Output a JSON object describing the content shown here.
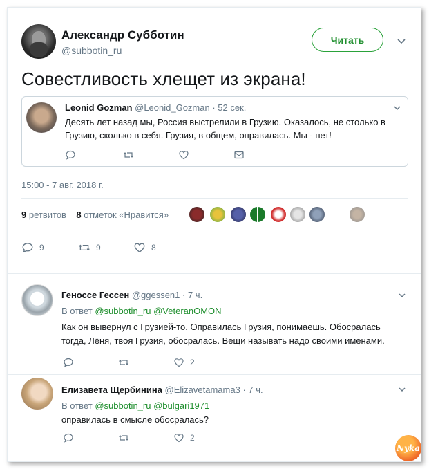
{
  "tweet": {
    "author_name": "Александр Субботин",
    "author_handle": "@subbotin_ru",
    "follow_label": "Читать",
    "text": "Совестливость хлещет из экрана!",
    "timestamp": "15:00 - 7 авг. 2018 г.",
    "retweets_count": "9",
    "retweets_label": "ретвитов",
    "likes_count": "8",
    "likes_label": "отметок «Нравится»",
    "reply_count": "9",
    "retweet_count_action": "9",
    "like_count_action": "8"
  },
  "quote": {
    "author_name": "Leonid Gozman",
    "author_handle": "@Leonid_Gozman",
    "time": "· 52 сек.",
    "text": "Десять лет назад мы, Россия выстрелили в Грузию. Оказалось, не столько в Грузию, сколько в себя. Грузия, в общем, оправилась. Мы - нет!"
  },
  "replies": [
    {
      "author_name": "Геноссе Гессен",
      "author_handle": "@ggessen1",
      "time": "· 7 ч.",
      "reply_to_prefix": "В ответ",
      "reply_to_1": "@subbotin_ru",
      "reply_to_2": "@VeteranOMON",
      "text": "Как он вывернул с Грузией-то. Оправилась Грузия, понимаешь. Обосралась тогда, Лёня, твоя Грузия, обосралась.  Вещи называть надо своими именами.",
      "like_count": "2"
    },
    {
      "author_name": "Елизавета Щербинина",
      "author_handle": "@Elizavetamama3",
      "time": "· 7 ч.",
      "reply_to_prefix": "В ответ",
      "reply_to_1": "@subbotin_ru",
      "reply_to_2": "@bulgari1971",
      "text": "оправилась в смысле обосралась?",
      "like_count": "2"
    }
  ],
  "watermark": "Nyka",
  "colors": {
    "accent_green": "#1f8f2e",
    "muted": "#657786",
    "border": "#e6ecf0"
  }
}
